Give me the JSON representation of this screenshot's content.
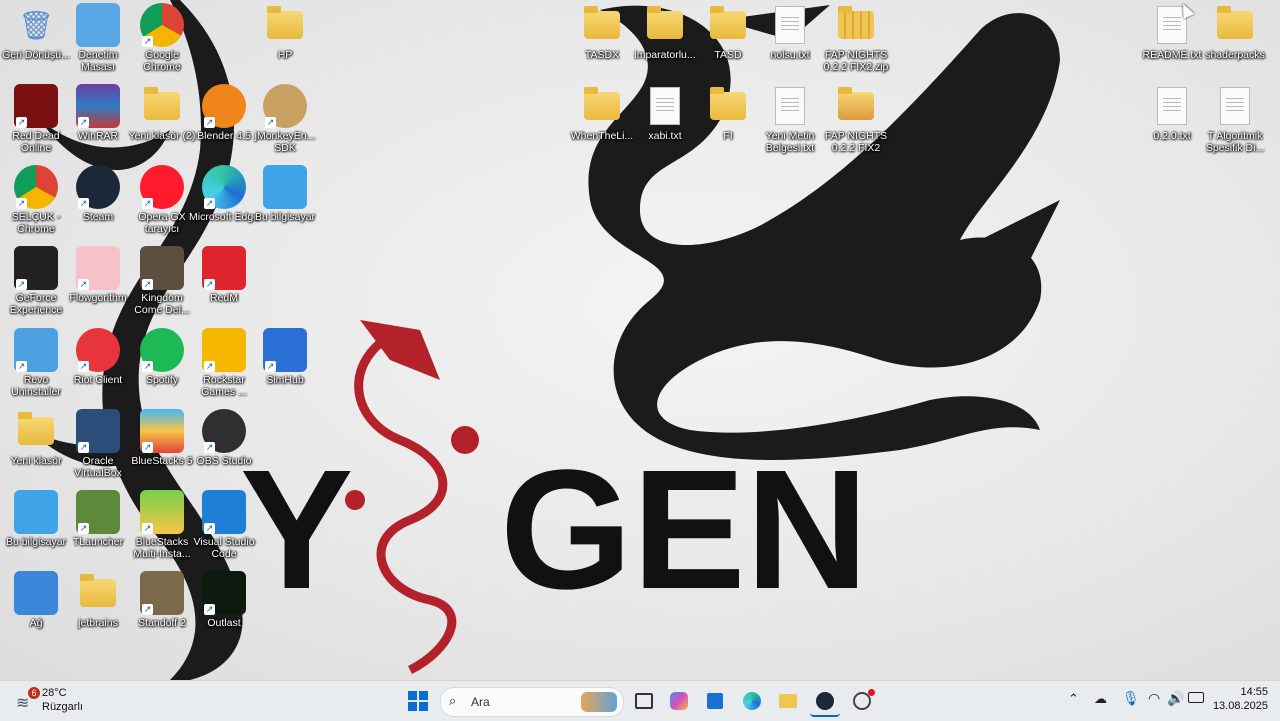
{
  "wallpaper": {
    "text": "Y  GEN"
  },
  "desktop_icons": [
    {
      "label": "Geri Dönüşü...",
      "kind": "recycle"
    },
    {
      "label": "Denetim Masası",
      "kind": "control"
    },
    {
      "label": "Google Chrome",
      "kind": "chrome"
    },
    {
      "label": "HP",
      "kind": "folder-user"
    },
    {
      "label": "Red Dead Online",
      "kind": "rdo"
    },
    {
      "label": "WinRAR",
      "kind": "winrar"
    },
    {
      "label": "Yeni klasör (2)",
      "kind": "folder"
    },
    {
      "label": "Blender 4.5",
      "kind": "blender"
    },
    {
      "label": "jMonkeyEn... SDK",
      "kind": "jmonkey"
    },
    {
      "label": "SELÇUK - Chrome",
      "kind": "chrome"
    },
    {
      "label": "Steam",
      "kind": "steam"
    },
    {
      "label": "Opera GX tarayıcı",
      "kind": "opera"
    },
    {
      "label": "Microsoft Edge",
      "kind": "edge"
    },
    {
      "label": "Bu bilgisayar",
      "kind": "pc"
    },
    {
      "label": "GeForce Experience",
      "kind": "nvidia"
    },
    {
      "label": "Flowgorithm",
      "kind": "flowgorithm"
    },
    {
      "label": "Kingdom Come Del...",
      "kind": "kcd"
    },
    {
      "label": "RedM",
      "kind": "redm"
    },
    {
      "label": "Revo Uninstaller",
      "kind": "revo"
    },
    {
      "label": "Riot Client",
      "kind": "riot"
    },
    {
      "label": "Spotify",
      "kind": "spotify"
    },
    {
      "label": "Rockstar Games ...",
      "kind": "rockstar"
    },
    {
      "label": "SimHub",
      "kind": "simhub"
    },
    {
      "label": "Yeni klasör",
      "kind": "folder"
    },
    {
      "label": "Oracle VirtualBox",
      "kind": "vbox"
    },
    {
      "label": "BlueStacks 5",
      "kind": "bluestacks"
    },
    {
      "label": "OBS Studio",
      "kind": "obs"
    },
    {
      "label": "Bu bilgisayar",
      "kind": "pc"
    },
    {
      "label": "TLauncher",
      "kind": "tlauncher"
    },
    {
      "label": "BlueStacks Multi-Insta...",
      "kind": "bsmulti"
    },
    {
      "label": "Visual Studio Code",
      "kind": "vscode"
    },
    {
      "label": "Ağ",
      "kind": "network"
    },
    {
      "label": "jetbrains",
      "kind": "folder"
    },
    {
      "label": "Standoff 2",
      "kind": "standoff"
    },
    {
      "label": "Outlast",
      "kind": "outlast"
    },
    {
      "label": "TASDX",
      "kind": "folder"
    },
    {
      "label": "imparatorlu...",
      "kind": "folder"
    },
    {
      "label": "TASD",
      "kind": "folder"
    },
    {
      "label": "nolsu.txt",
      "kind": "txt"
    },
    {
      "label": "FAP NIGHTS 0.2.2 FIX2.zip",
      "kind": "zip"
    },
    {
      "label": "WhenTheLi...",
      "kind": "folder"
    },
    {
      "label": "xabi.txt",
      "kind": "txt"
    },
    {
      "label": "FI",
      "kind": "folder"
    },
    {
      "label": "Yeni Metin Belgesi.txt",
      "kind": "txt"
    },
    {
      "label": "FAP NIGHTS 0.2.2 FIX2",
      "kind": "folder-img"
    },
    {
      "label": "README.txt",
      "kind": "txt"
    },
    {
      "label": "shaderpacks",
      "kind": "folder"
    },
    {
      "label": "0.2.0.txt",
      "kind": "txt"
    },
    {
      "label": "T Algoritmik Spesifik Di...",
      "kind": "txt"
    }
  ],
  "taskbar": {
    "weather": {
      "badge": "6",
      "temp": "28°C",
      "desc": "Rüzgarlı"
    },
    "search_placeholder": "Ara",
    "clock": {
      "time": "14:55",
      "date": "13.08.2025"
    }
  },
  "colors": {
    "taskbar_bg": "#e9ecef",
    "folder": "#f0c552",
    "accent": "#0067c0",
    "dragon_red": "#b3222a"
  }
}
